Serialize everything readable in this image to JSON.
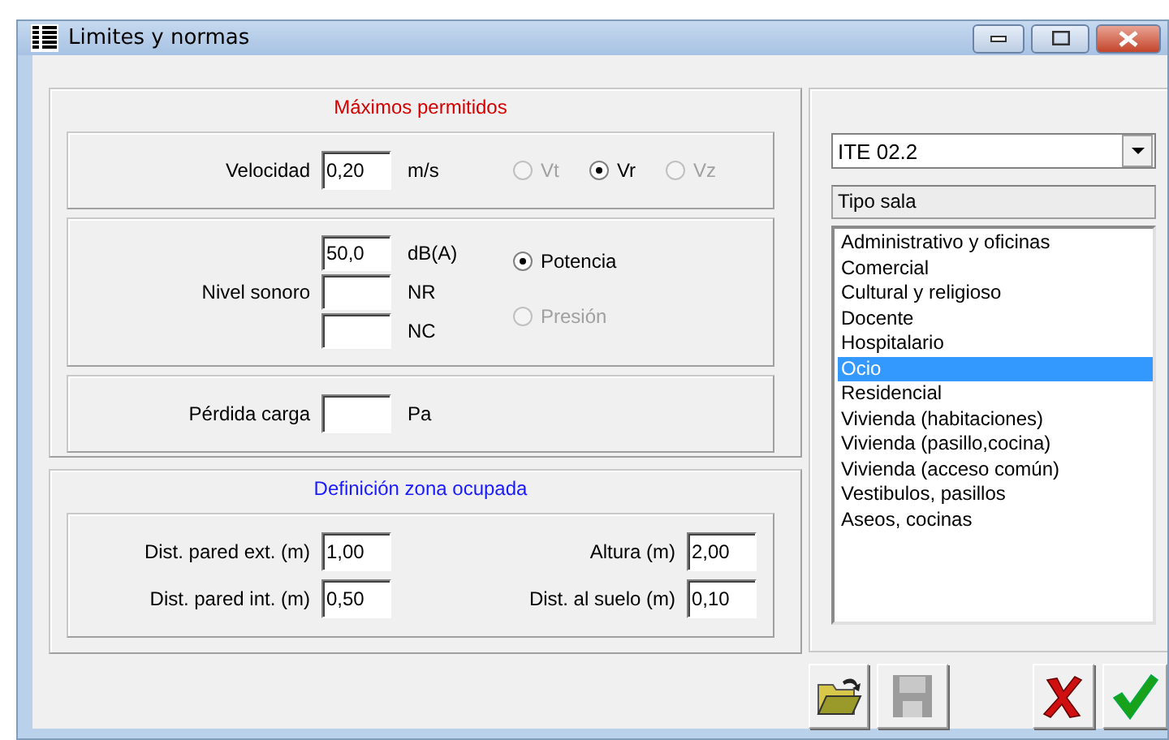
{
  "window": {
    "title": "Limites y normas"
  },
  "maximos": {
    "title": "Máximos permitidos",
    "velocidad": {
      "label": "Velocidad",
      "value": "0,20",
      "unit": "m/s"
    },
    "components": [
      {
        "label": "Vt",
        "selected": false,
        "disabled": true
      },
      {
        "label": "Vr",
        "selected": true,
        "disabled": false
      },
      {
        "label": "Vz",
        "selected": false,
        "disabled": true
      }
    ],
    "nivel_sonoro": {
      "label": "Nivel sonoro",
      "fields": [
        {
          "value": "50,0",
          "unit": "dB(A)"
        },
        {
          "unit": "NR"
        },
        {
          "unit": "NC"
        }
      ]
    },
    "modes": [
      {
        "label": "Potencia",
        "selected": true,
        "disabled": false
      },
      {
        "label": "Presión",
        "selected": false,
        "disabled": true
      }
    ],
    "perdida": {
      "label": "Pérdida carga",
      "unit": "Pa"
    }
  },
  "zona": {
    "title": "Definición zona ocupada",
    "fields": [
      {
        "label": "Dist. pared ext. (m)",
        "value": "1,00"
      },
      {
        "label": "Altura (m)",
        "value": "2,00"
      },
      {
        "label": "Dist. pared int. (m)",
        "value": "0,50"
      },
      {
        "label": "Dist. al suelo (m)",
        "value": "0,10"
      }
    ]
  },
  "norma": {
    "value": "ITE 02.2"
  },
  "tipo_sala": {
    "header": "Tipo sala",
    "items": [
      {
        "label": "Administrativo y oficinas",
        "selected": false
      },
      {
        "label": "Comercial",
        "selected": false
      },
      {
        "label": "Cultural y religioso",
        "selected": false
      },
      {
        "label": "Docente",
        "selected": false
      },
      {
        "label": "Hospitalario",
        "selected": false
      },
      {
        "label": "Ocio",
        "selected": true
      },
      {
        "label": "Residencial",
        "selected": false
      },
      {
        "label": "Vivienda (habitaciones)",
        "selected": false
      },
      {
        "label": "Vivienda (pasillo,cocina)",
        "selected": false
      },
      {
        "label": "Vivienda (acceso común)",
        "selected": false
      },
      {
        "label": "Vestibulos, pasillos",
        "selected": false
      },
      {
        "label": "Aseos, cocinas",
        "selected": false
      }
    ]
  },
  "buttons": [
    {
      "kind": "open"
    },
    {
      "kind": "save",
      "disabled": true
    },
    {
      "kind": "cancel"
    },
    {
      "kind": "ok"
    }
  ]
}
